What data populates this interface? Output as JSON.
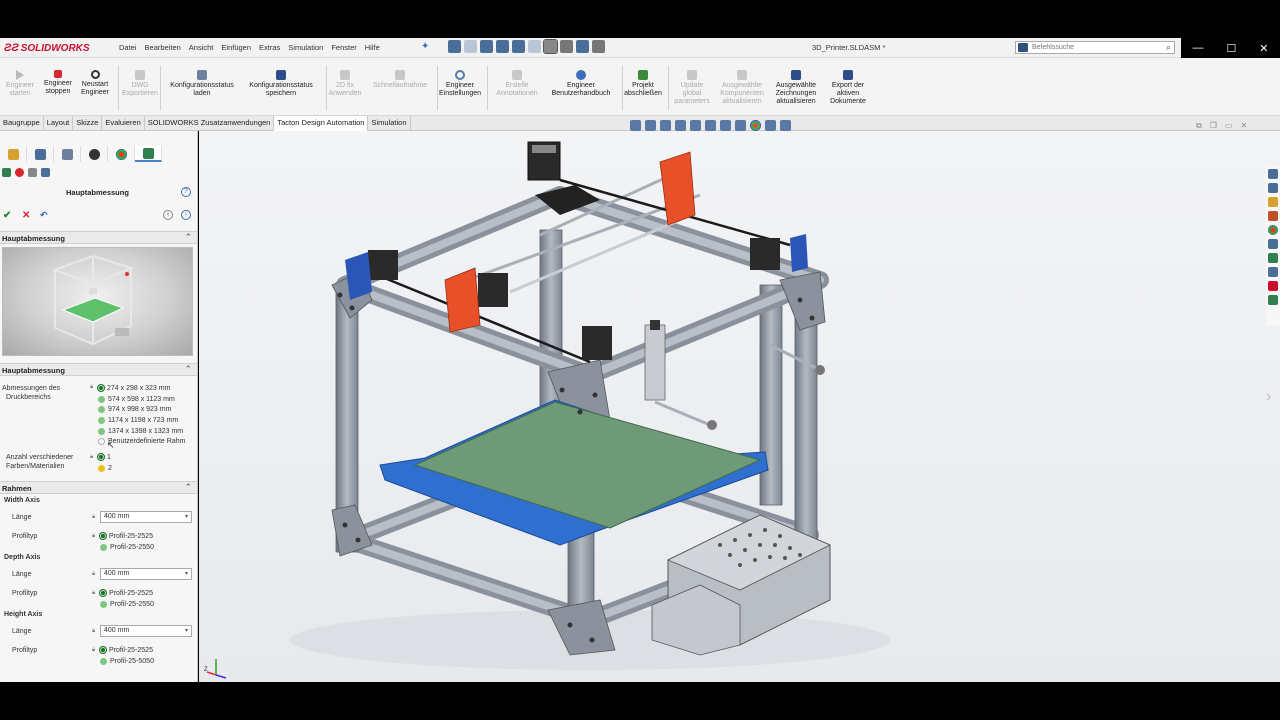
{
  "app": {
    "brand": "SOLIDWORKS",
    "document_title": "3D_Printer.SLDASM *",
    "search_placeholder": "Befehlssuche",
    "menu": [
      "Datei",
      "Bearbeiten",
      "Ansicht",
      "Einfügen",
      "Extras",
      "Simulation",
      "Fenster",
      "Hilfe"
    ]
  },
  "ribbon": {
    "buttons": [
      {
        "label1": "Engineer",
        "label2": "starten",
        "enabled": false,
        "icon": "play-icon"
      },
      {
        "label1": "Engineer",
        "label2": "stoppen",
        "enabled": true,
        "icon": "stop-icon"
      },
      {
        "label1": "Neustart",
        "label2": "Engineer",
        "enabled": true,
        "icon": "restart-icon"
      },
      {
        "label1": "DWG",
        "label2": "Exportieren",
        "enabled": false,
        "icon": "dwg-icon"
      },
      {
        "label1": "Konfigurationsstatus",
        "label2": "laden",
        "enabled": true,
        "icon": "config-load-icon"
      },
      {
        "label1": "Konfigurationsstatus",
        "label2": "speichern",
        "enabled": true,
        "icon": "config-save-icon"
      },
      {
        "label1": "2D fix",
        "label2": "Anwenden",
        "enabled": false,
        "icon": "fix2d-icon"
      },
      {
        "label1": "Schnellaufnahme",
        "label2": "",
        "enabled": false,
        "icon": "snapshot-icon"
      },
      {
        "label1": "Engineer",
        "label2": "Einstellungen",
        "enabled": true,
        "icon": "settings-gear-icon"
      },
      {
        "label1": "Erstelle",
        "label2": "Annotationen",
        "enabled": false,
        "icon": "annotation-icon"
      },
      {
        "label1": "Engineer",
        "label2": "Benutzerhandbuch",
        "enabled": true,
        "icon": "help-book-icon"
      },
      {
        "label1": "Projekt",
        "label2": "abschließen",
        "enabled": true,
        "icon": "project-finish-icon"
      },
      {
        "label1": "Update",
        "label2": "global",
        "label3": "parameters",
        "enabled": false,
        "icon": "update-icon"
      },
      {
        "label1": "Ausgewählte",
        "label2": "Komponenten",
        "label3": "aktualisieren",
        "enabled": false,
        "icon": "components-update-icon"
      },
      {
        "label1": "Ausgewählte",
        "label2": "Zeichnungen",
        "label3": "aktualisieren",
        "enabled": true,
        "icon": "drawings-update-icon"
      },
      {
        "label1": "Export der",
        "label2": "aktiven",
        "label3": "Dokumente",
        "enabled": true,
        "icon": "export-icon"
      }
    ]
  },
  "tabs": [
    "Baugruppe",
    "Layout",
    "Skizze",
    "Evaluieren",
    "SOLIDWORKS Zusatzanwendungen",
    "Tacton Design Automation",
    "Simulation"
  ],
  "active_tab": "Tacton Design Automation",
  "panel": {
    "title": "Hauptabmessung",
    "section1": "Hauptabmessung",
    "section2": "Hauptabmessung",
    "druck_label1": "Abmessungen des",
    "druck_label2": "Druckbereichs",
    "druck_options": [
      "274 x 298 x 323 mm",
      "574 x 598 x 1123 mm",
      "974 x 998 x 923 mm",
      "1174 x 1198 x 723 mm",
      "1374 x 1398 x 1323 mm",
      "Benutzerdefinierte Rahm"
    ],
    "farben_label1": "Anzahl verschiedener",
    "farben_label2": "Farben/Materialien",
    "farben_options": [
      "1",
      "2"
    ],
    "rahmen": "Rahmen",
    "axes": [
      {
        "name": "Width Axis",
        "laenge_label": "Länge",
        "laenge": "400 mm",
        "profil_label": "Profiltyp",
        "profile": [
          "Profil-25-2525",
          "Profil-25-2550"
        ]
      },
      {
        "name": "Depth Axis",
        "laenge_label": "Länge",
        "laenge": "400 mm",
        "profil_label": "Profiltyp",
        "profile": [
          "Profil-25-2525",
          "Profil-25-2550"
        ]
      },
      {
        "name": "Height Axis",
        "laenge_label": "Länge",
        "laenge": "400 mm",
        "profil_label": "Profiltyp",
        "profile": [
          "Profil-25-2525",
          "Profil-25-5050"
        ]
      }
    ]
  },
  "colors": {
    "accent": "#c8102e",
    "frame": "#9aa2ae",
    "bed": "#6f9a78",
    "bed_frame": "#2f6fd0",
    "carriage": "#e8502a"
  }
}
